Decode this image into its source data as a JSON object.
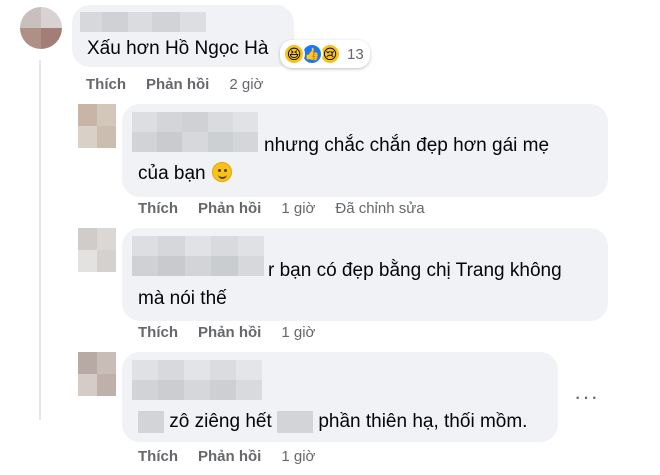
{
  "comments": [
    {
      "text": "Xấu hơn Hồ Ngọc Hà",
      "reactions": {
        "icons": [
          "haha-icon",
          "like-icon",
          "sad-icon"
        ],
        "count": "13"
      },
      "actions": {
        "like": "Thích",
        "reply": "Phản hồi",
        "time": "2 giờ"
      }
    },
    {
      "text_line1": "nhưng chắc chắn đẹp hơn gái mẹ",
      "text_line2": "của bạn",
      "actions": {
        "like": "Thích",
        "reply": "Phản hồi",
        "time": "1 giờ",
        "edited": "Đã chỉnh sửa"
      }
    },
    {
      "text_line1": "r bạn có đẹp bằng chị Trang không",
      "text_line2": "mà nói thế",
      "actions": {
        "like": "Thích",
        "reply": "Phản hồi",
        "time": "1 giờ"
      }
    },
    {
      "text_part1": "zô ziêng hết",
      "text_part2": "phần thiên hạ, thối mồm.",
      "actions": {
        "like": "Thích",
        "reply": "Phản hồi",
        "time": "1 giờ"
      },
      "more": "···"
    }
  ],
  "colors": {
    "bubble": "#f0f2f5",
    "secondary_text": "#65676b",
    "like_blue": "#1877f2",
    "reaction_yellow": "#f7c31a"
  }
}
